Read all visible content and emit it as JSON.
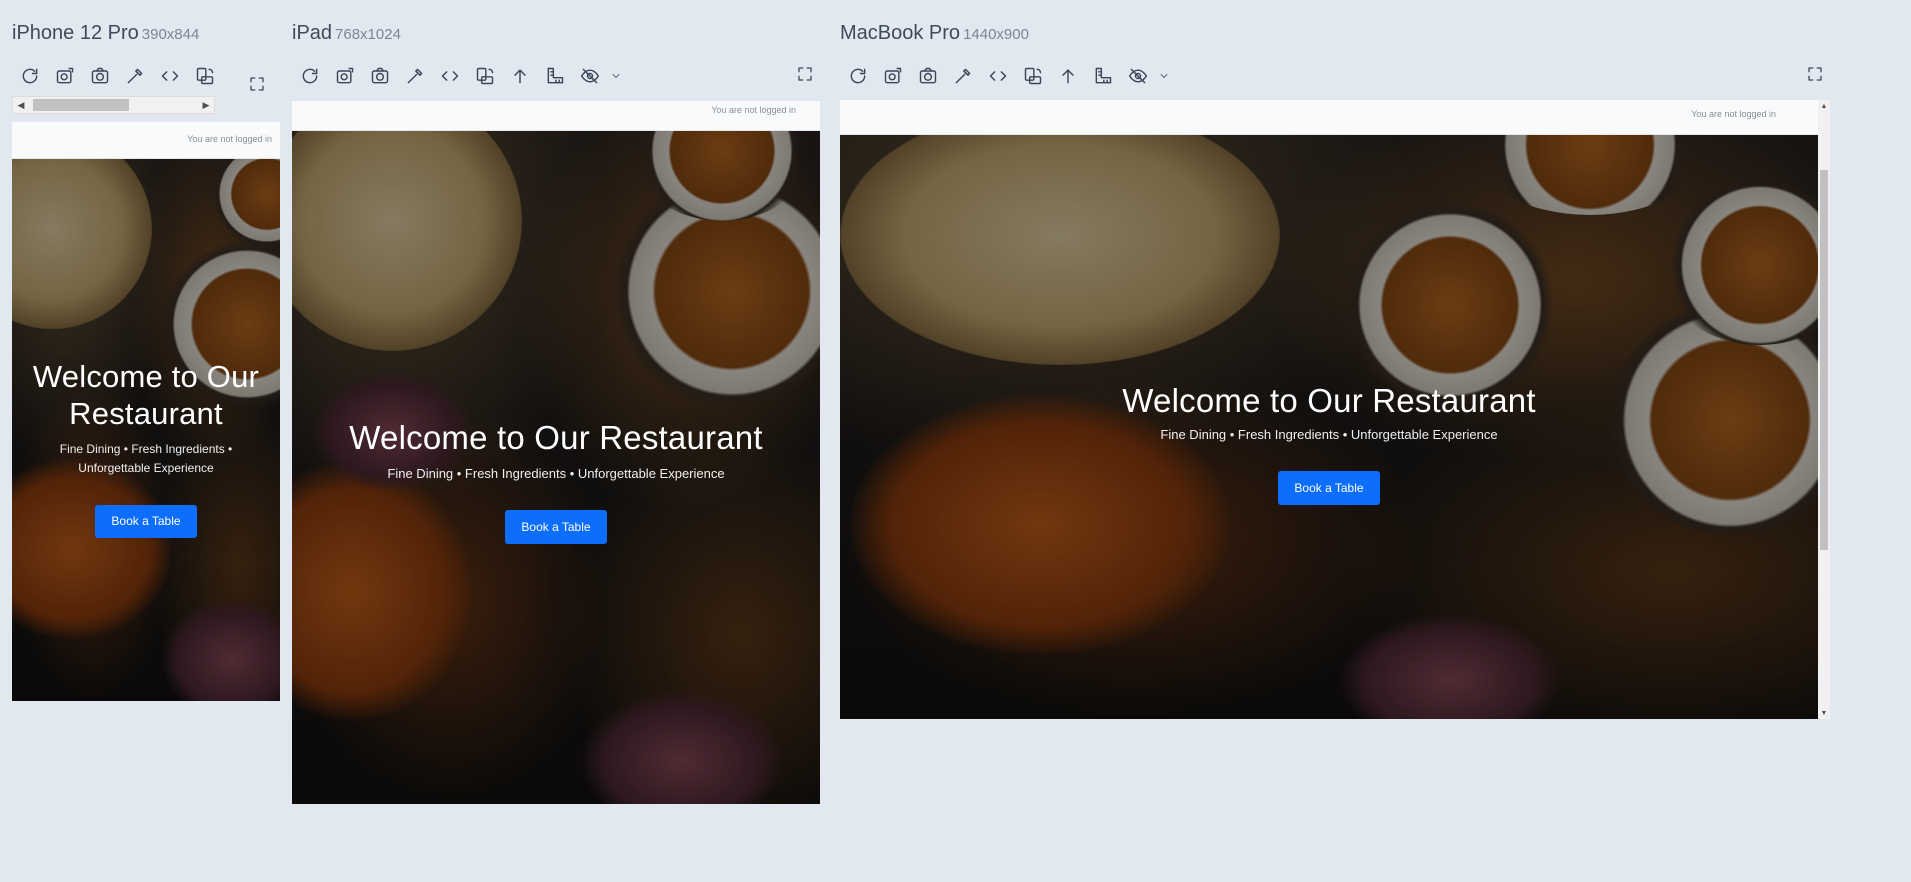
{
  "devices": [
    {
      "name": "iPhone 12 Pro",
      "dims": "390x844",
      "status": "You are not logged in",
      "hero_title": "Welcome to Our Restaurant",
      "hero_subtitle": "Fine Dining • Fresh Ingredients • Unforgettable Experience",
      "cta": "Book a Table"
    },
    {
      "name": "iPad",
      "dims": "768x1024",
      "status": "You are not logged in",
      "hero_title": "Welcome to Our Restaurant",
      "hero_subtitle": "Fine Dining • Fresh Ingredients • Unforgettable Experience",
      "cta": "Book a Table"
    },
    {
      "name": "MacBook Pro",
      "dims": "1440x900",
      "status": "You are not logged in",
      "hero_title": "Welcome to Our Restaurant",
      "hero_subtitle": "Fine Dining • Fresh Ingredients • Unforgettable Experience",
      "cta": "Book a Table"
    }
  ],
  "toolbar_icons": [
    "refresh-icon",
    "screenshot-full-icon",
    "camera-icon",
    "eyedropper-icon",
    "code-icon",
    "rotate-device-icon",
    "scroll-up-icon",
    "ruler-icon",
    "hide-icon",
    "chevron-down-icon"
  ],
  "colors": {
    "page_bg": "#e2e8f0",
    "cta_bg": "#0d6efd",
    "text": "#3f4a5a"
  }
}
